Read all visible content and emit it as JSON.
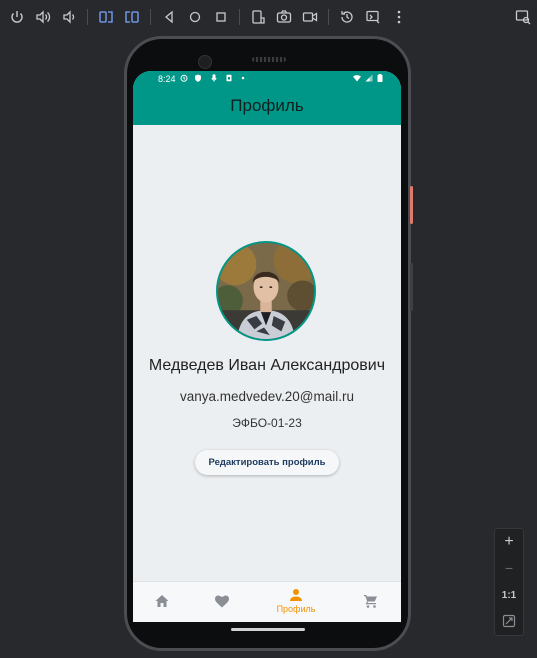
{
  "toolbar": {
    "icons": [
      "power-icon",
      "volume-up-icon",
      "volume-down-icon",
      "rotate-left-icon",
      "rotate-right-icon",
      "back-icon",
      "home-icon",
      "overview-icon",
      "fold-icon",
      "screenshot-icon",
      "screen-record-icon",
      "snapshot-icon",
      "extended-controls-icon",
      "more-icon",
      "device-explorer-icon"
    ]
  },
  "status_bar": {
    "time": "8:24"
  },
  "app_bar": {
    "title": "Профиль"
  },
  "profile": {
    "name": "Медведев Иван Александрович",
    "email": "vanya.medvedev.20@mail.ru",
    "group": "ЭФБО-01-23",
    "edit_button_label": "Редактировать профиль"
  },
  "bottom_nav": {
    "items": [
      {
        "icon": "home-icon",
        "label": ""
      },
      {
        "icon": "heart-icon",
        "label": ""
      },
      {
        "icon": "person-icon",
        "label": "Профиль",
        "active": true
      },
      {
        "icon": "cart-icon",
        "label": ""
      }
    ]
  },
  "zoom_panel": {
    "zoom_in": "+",
    "zoom_out": "−",
    "actual_size": "1:1"
  },
  "colors": {
    "accent": "#009688",
    "active_nav": "#f29200",
    "background": "#eceff1"
  }
}
